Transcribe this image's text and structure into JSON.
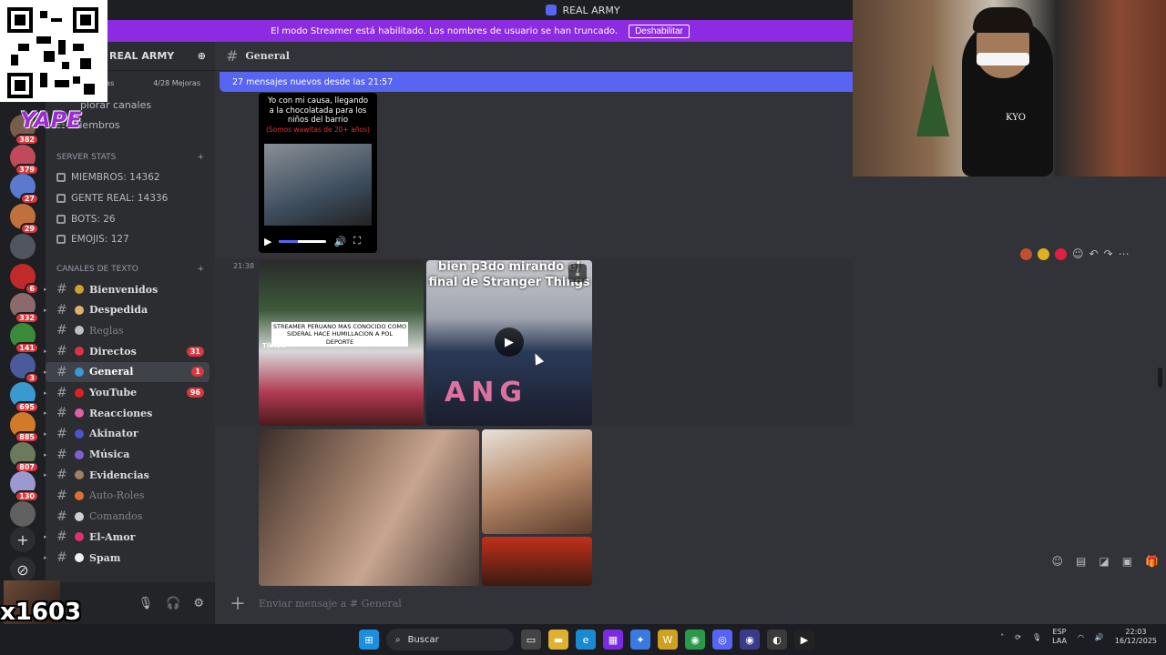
{
  "window": {
    "title": "REAL ARMY"
  },
  "streamer_bar": {
    "message": "El modo Streamer está habilitado. Los nombres de usuario se han truncado.",
    "button": "Deshabilitar"
  },
  "overlay": {
    "yape": "YAPE",
    "counter": "x1603"
  },
  "guilds": [
    {
      "badge": "382",
      "color": "#7a5c4a"
    },
    {
      "badge": "379",
      "color": "#c04a5a"
    },
    {
      "badge": "27",
      "color": "#5a7ad0"
    },
    {
      "badge": "29",
      "color": "#c0703a"
    },
    {
      "badge": "",
      "color": "#505560"
    },
    {
      "badge": "6",
      "color": "#c02a2a"
    },
    {
      "badge": "332",
      "color": "#8a6a6a"
    },
    {
      "badge": "141",
      "color": "#3a8a3a"
    },
    {
      "badge": "3",
      "color": "#4a5a9a"
    },
    {
      "badge": "695",
      "color": "#3a9ad0"
    },
    {
      "badge": "885",
      "color": "#d07a2a"
    },
    {
      "badge": "807",
      "color": "#6a7a5a"
    },
    {
      "badge": "130",
      "color": "#9a9ad0"
    },
    {
      "badge": "",
      "color": "#606060"
    }
  ],
  "sidebar": {
    "server_name": "REAL ARMY",
    "boost_left": "oras",
    "boost_right": "4/28 Mejoras",
    "browse": "plorar canales",
    "members": "Miembros",
    "stats_category": "SERVER STATS",
    "stats": [
      "MIEMBROS: 14362",
      "GENTE REAL: 14336",
      "BOTS: 26",
      "EMOJIS: 127"
    ],
    "text_category": "CANALES DE TEXTO",
    "channels": [
      {
        "name": "Bienvenidos",
        "count": "",
        "muted": false,
        "active": false,
        "color": "#d0a030"
      },
      {
        "name": "Despedida",
        "count": "",
        "muted": false,
        "active": false,
        "color": "#e0b070"
      },
      {
        "name": "Reglas",
        "count": "",
        "muted": true,
        "active": false,
        "color": "#c0c0c0"
      },
      {
        "name": "Directos",
        "count": "31",
        "muted": false,
        "active": false,
        "color": "#e03050"
      },
      {
        "name": "General",
        "count": "1",
        "muted": false,
        "active": true,
        "color": "#3a9ad0"
      },
      {
        "name": "YouTube",
        "count": "96",
        "muted": false,
        "active": false,
        "color": "#e02020"
      },
      {
        "name": "Reacciones",
        "count": "",
        "muted": false,
        "active": false,
        "color": "#e060a0"
      },
      {
        "name": "Akinator",
        "count": "",
        "muted": false,
        "active": false,
        "color": "#5050d0"
      },
      {
        "name": "Música",
        "count": "",
        "muted": false,
        "active": false,
        "color": "#8060d0"
      },
      {
        "name": "Evidencias",
        "count": "",
        "muted": false,
        "active": false,
        "color": "#a08060"
      },
      {
        "name": "Auto-Roles",
        "count": "",
        "muted": true,
        "active": false,
        "color": "#e07030"
      },
      {
        "name": "Comandos",
        "count": "",
        "muted": true,
        "active": false,
        "color": "#d0d0d0"
      },
      {
        "name": "El-Amor",
        "count": "",
        "muted": false,
        "active": false,
        "color": "#e03070"
      },
      {
        "name": "Spam",
        "count": "",
        "muted": false,
        "active": false,
        "color": "#f0f0f0"
      }
    ]
  },
  "channel": {
    "name": "General",
    "new_messages": "27 mensajes nuevos desde las 21:57",
    "placeholder": "Enviar mensaje a #",
    "placeholder_channel": "General"
  },
  "messages": {
    "video1_caption": "Yo con mi causa, llegando a la chocolatada para los niños del barrio",
    "video1_sub": "(Somos wawitas de 20+ años)",
    "timestamp": "21:38",
    "tile1_text": "STREAMER PERUANO MAS CONOCIDO COMO SIDERAL HACE HUMILLACION A POL DEPORTE",
    "tile1_brand": "TikTok",
    "tile2_text": "bien p3do mirando el final de Stranger Things",
    "tile2_neon": "ANG"
  },
  "webcam": {
    "shirt_text": "KYO"
  },
  "taskbar": {
    "search": "Buscar",
    "lang_top": "ESP",
    "lang_bottom": "LAA",
    "time": "22:03",
    "date": "16/12/2025"
  }
}
